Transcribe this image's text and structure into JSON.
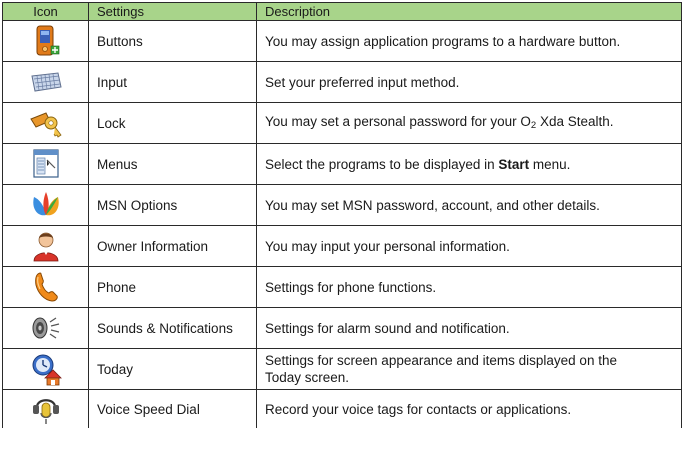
{
  "table": {
    "headers": {
      "icon": "Icon",
      "settings": "Settings",
      "description": "Description"
    },
    "rows": [
      {
        "icon": "pda-icon",
        "setting": "Buttons",
        "description": "You may assign application programs to a hardware button."
      },
      {
        "icon": "keyboard-icon",
        "setting": "Input",
        "description": "Set your preferred input method."
      },
      {
        "icon": "key-lock-icon",
        "setting": "Lock",
        "description_parts": {
          "before": "You may set a personal password for your O",
          "sub": "2",
          "after": " Xda Stealth."
        }
      },
      {
        "icon": "window-menu-icon",
        "setting": "Menus",
        "description_parts": {
          "before": "Select the programs to be displayed in ",
          "bold": "Start",
          "after": " menu."
        }
      },
      {
        "icon": "msn-butterfly-icon",
        "setting": "MSN Options",
        "description": "You may set MSN password, account, and other details."
      },
      {
        "icon": "person-icon",
        "setting": "Owner Information",
        "description": "You may input your personal information."
      },
      {
        "icon": "phone-handset-icon",
        "setting": "Phone",
        "description": "Settings for phone functions."
      },
      {
        "icon": "speaker-icon",
        "setting": "Sounds & Notifications",
        "description": "Settings for alarm sound and notification."
      },
      {
        "icon": "today-clock-house-icon",
        "setting": "Today",
        "description_lines": [
          "Settings for screen appearance and  items displayed on the",
          "Today screen."
        ]
      },
      {
        "icon": "voice-speed-dial-icon",
        "setting": "Voice Speed Dial",
        "description": "Record your voice tags for contacts or applications."
      }
    ]
  },
  "colors": {
    "header_background": "#a8d48a",
    "border": "#2a2a2a"
  }
}
